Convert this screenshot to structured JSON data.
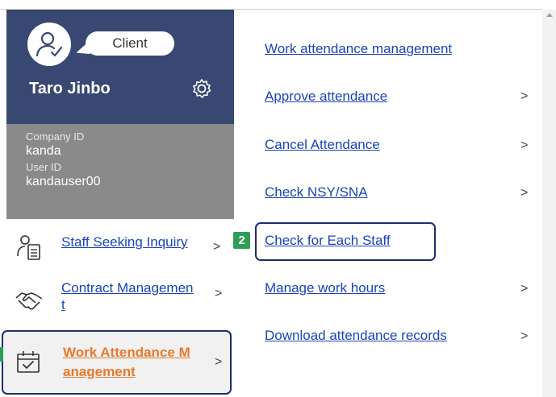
{
  "profile": {
    "role": "Client",
    "user_name": "Taro Jinbo",
    "company_id_label": "Company ID",
    "company_id": "kanda",
    "user_id_label": "User ID",
    "user_id": "kandauser00",
    "colors": {
      "header_bg": "#384872",
      "ids_bg": "#8a8a8a"
    }
  },
  "menu": {
    "items": [
      {
        "label": "Staff Seeking Inquiry",
        "icon": "staff-profile-icon",
        "active": false
      },
      {
        "label_line1": "Contract Managemen",
        "label_line2": "t",
        "icon": "handshake-icon",
        "active": false
      },
      {
        "label_line1": "Work Attendance M",
        "label_line2": "anagement",
        "icon": "calendar-check-icon",
        "active": true
      }
    ],
    "chevron": ">"
  },
  "submenu": {
    "items": [
      {
        "label": "Work attendance management",
        "has_chevron": false
      },
      {
        "label": "Approve attendance",
        "has_chevron": true
      },
      {
        "label": "Cancel Attendance",
        "has_chevron": true
      },
      {
        "label": "Check NSY/SNA",
        "has_chevron": true
      },
      {
        "label": "Check for Each Staff",
        "has_chevron": false,
        "highlighted": true
      },
      {
        "label": "Manage work hours",
        "has_chevron": true
      },
      {
        "label": "Download attendance records",
        "has_chevron": true
      }
    ],
    "chevron": ">"
  },
  "annotations": {
    "step_number": "2",
    "accent_color": "#2e9d57",
    "highlight_color": "#1b2f6b"
  }
}
